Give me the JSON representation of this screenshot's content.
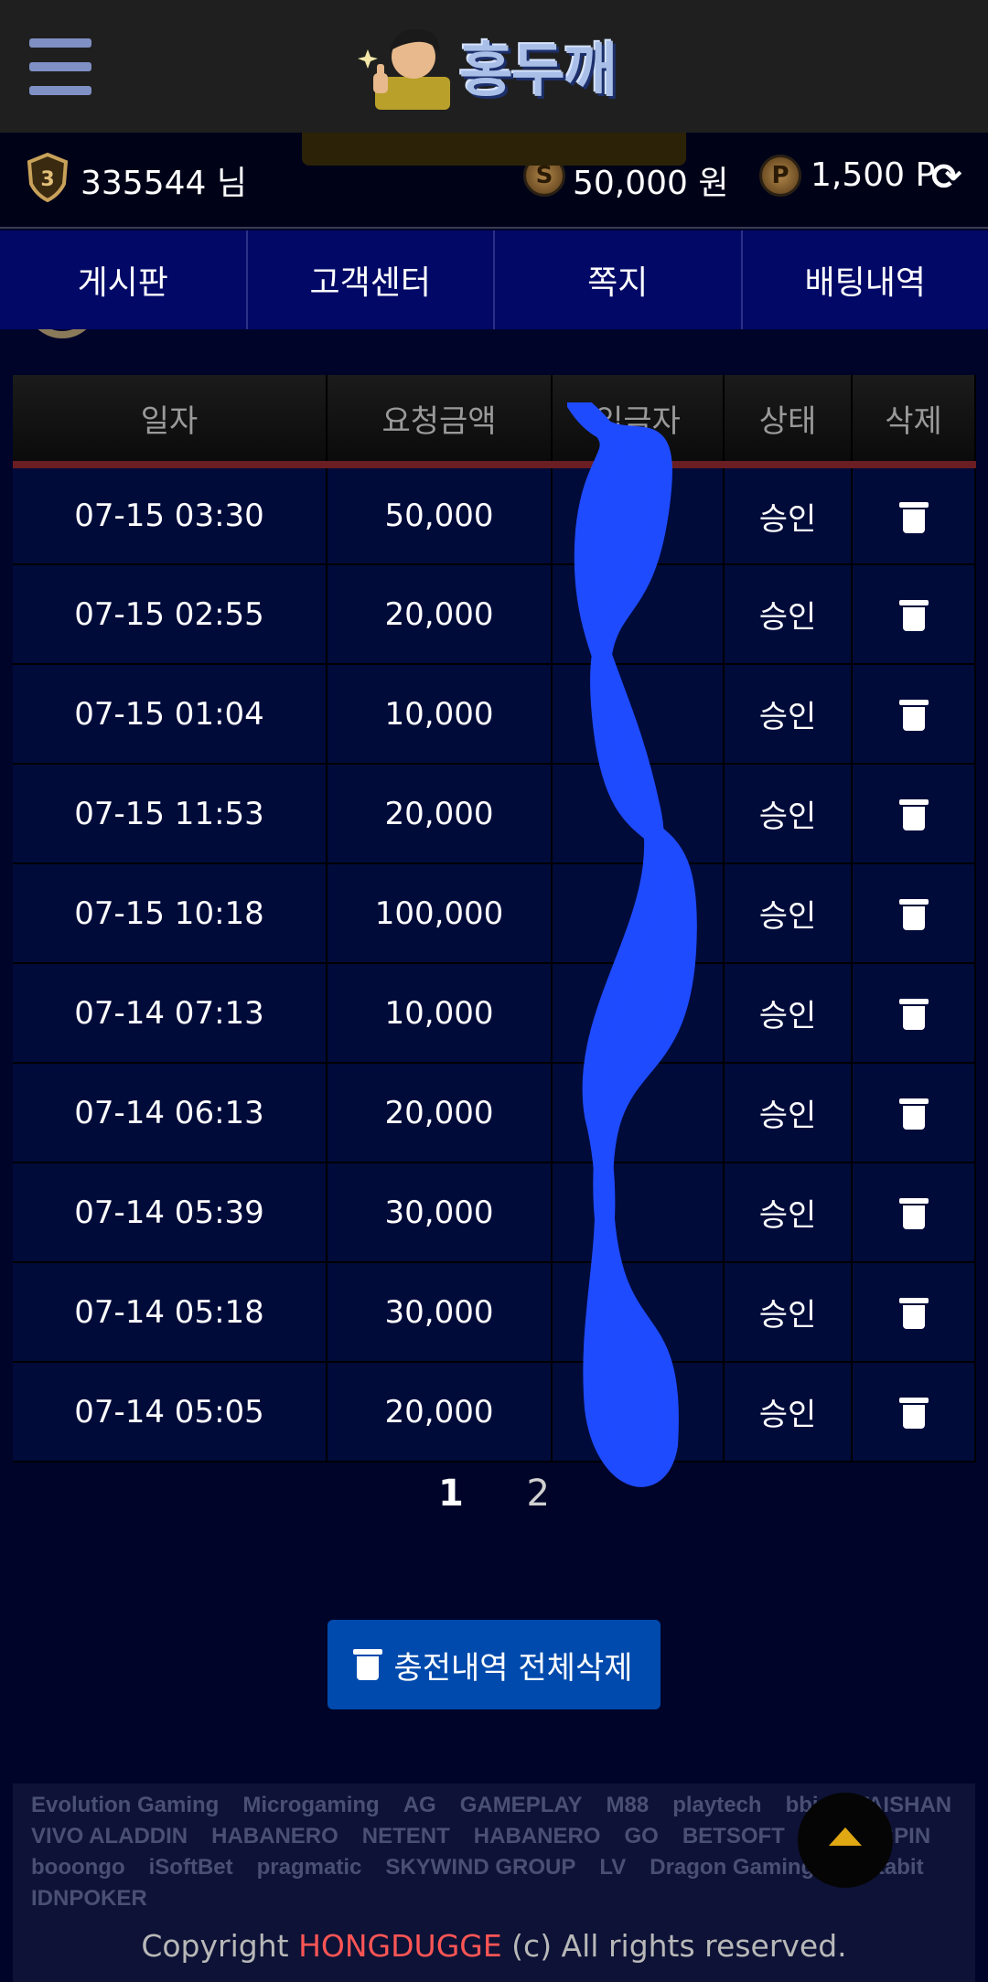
{
  "header": {
    "logo_text": "홍두깨",
    "menu_icon": "hamburger-menu-icon"
  },
  "user": {
    "level": "3",
    "username": "335544 님",
    "money": "50,000 원",
    "points": "1,500 P",
    "money_icon_letter": "S",
    "point_icon_letter": "P"
  },
  "nav": {
    "items": [
      "게시판",
      "고객센터",
      "쪽지",
      "배팅내역"
    ]
  },
  "table": {
    "headers": [
      "일자",
      "요청금액",
      "입금자",
      "상태",
      "삭제"
    ],
    "rows": [
      {
        "date": "07-15 03:30",
        "amount": "50,000",
        "status": "승인"
      },
      {
        "date": "07-15 02:55",
        "amount": "20,000",
        "status": "승인"
      },
      {
        "date": "07-15 01:04",
        "amount": "10,000",
        "status": "승인"
      },
      {
        "date": "07-15 11:53",
        "amount": "20,000",
        "status": "승인"
      },
      {
        "date": "07-15 10:18",
        "amount": "100,000",
        "status": "승인"
      },
      {
        "date": "07-14 07:13",
        "amount": "10,000",
        "status": "승인"
      },
      {
        "date": "07-14 06:13",
        "amount": "20,000",
        "status": "승인"
      },
      {
        "date": "07-14 05:39",
        "amount": "30,000",
        "status": "승인"
      },
      {
        "date": "07-14 05:18",
        "amount": "30,000",
        "status": "승인"
      },
      {
        "date": "07-14 05:05",
        "amount": "20,000",
        "status": "승인"
      }
    ]
  },
  "pagination": {
    "pages": [
      "1",
      "2"
    ],
    "current": "1"
  },
  "delete_all_label": "충전내역 전체삭제",
  "footer": {
    "providers": [
      "Evolution Gaming",
      "Microgaming",
      "AG",
      "GAMEPLAY",
      "M88",
      "playtech",
      "bbin",
      "TAISHAN",
      "VIVO ALADDIN",
      "HABANERO",
      "NETENT",
      "HABANERO",
      "GO",
      "BETSOFT",
      "QUICKSPIN",
      "booongo",
      "iSoftBet",
      "pragmatic",
      "SKYWIND GROUP",
      "LV",
      "Dragon Gaming",
      "bustabit",
      "IDNPOKER"
    ],
    "copyright_prefix": "Copyright ",
    "copyright_brand": "HONGDUGGE",
    "copyright_suffix": " (c) All rights reserved."
  },
  "colors": {
    "topbar": "#1f1f1f",
    "nav": "#010866",
    "accent_button": "#004aad",
    "brand_red": "#ff5555",
    "scribble": "#1f4bff"
  }
}
